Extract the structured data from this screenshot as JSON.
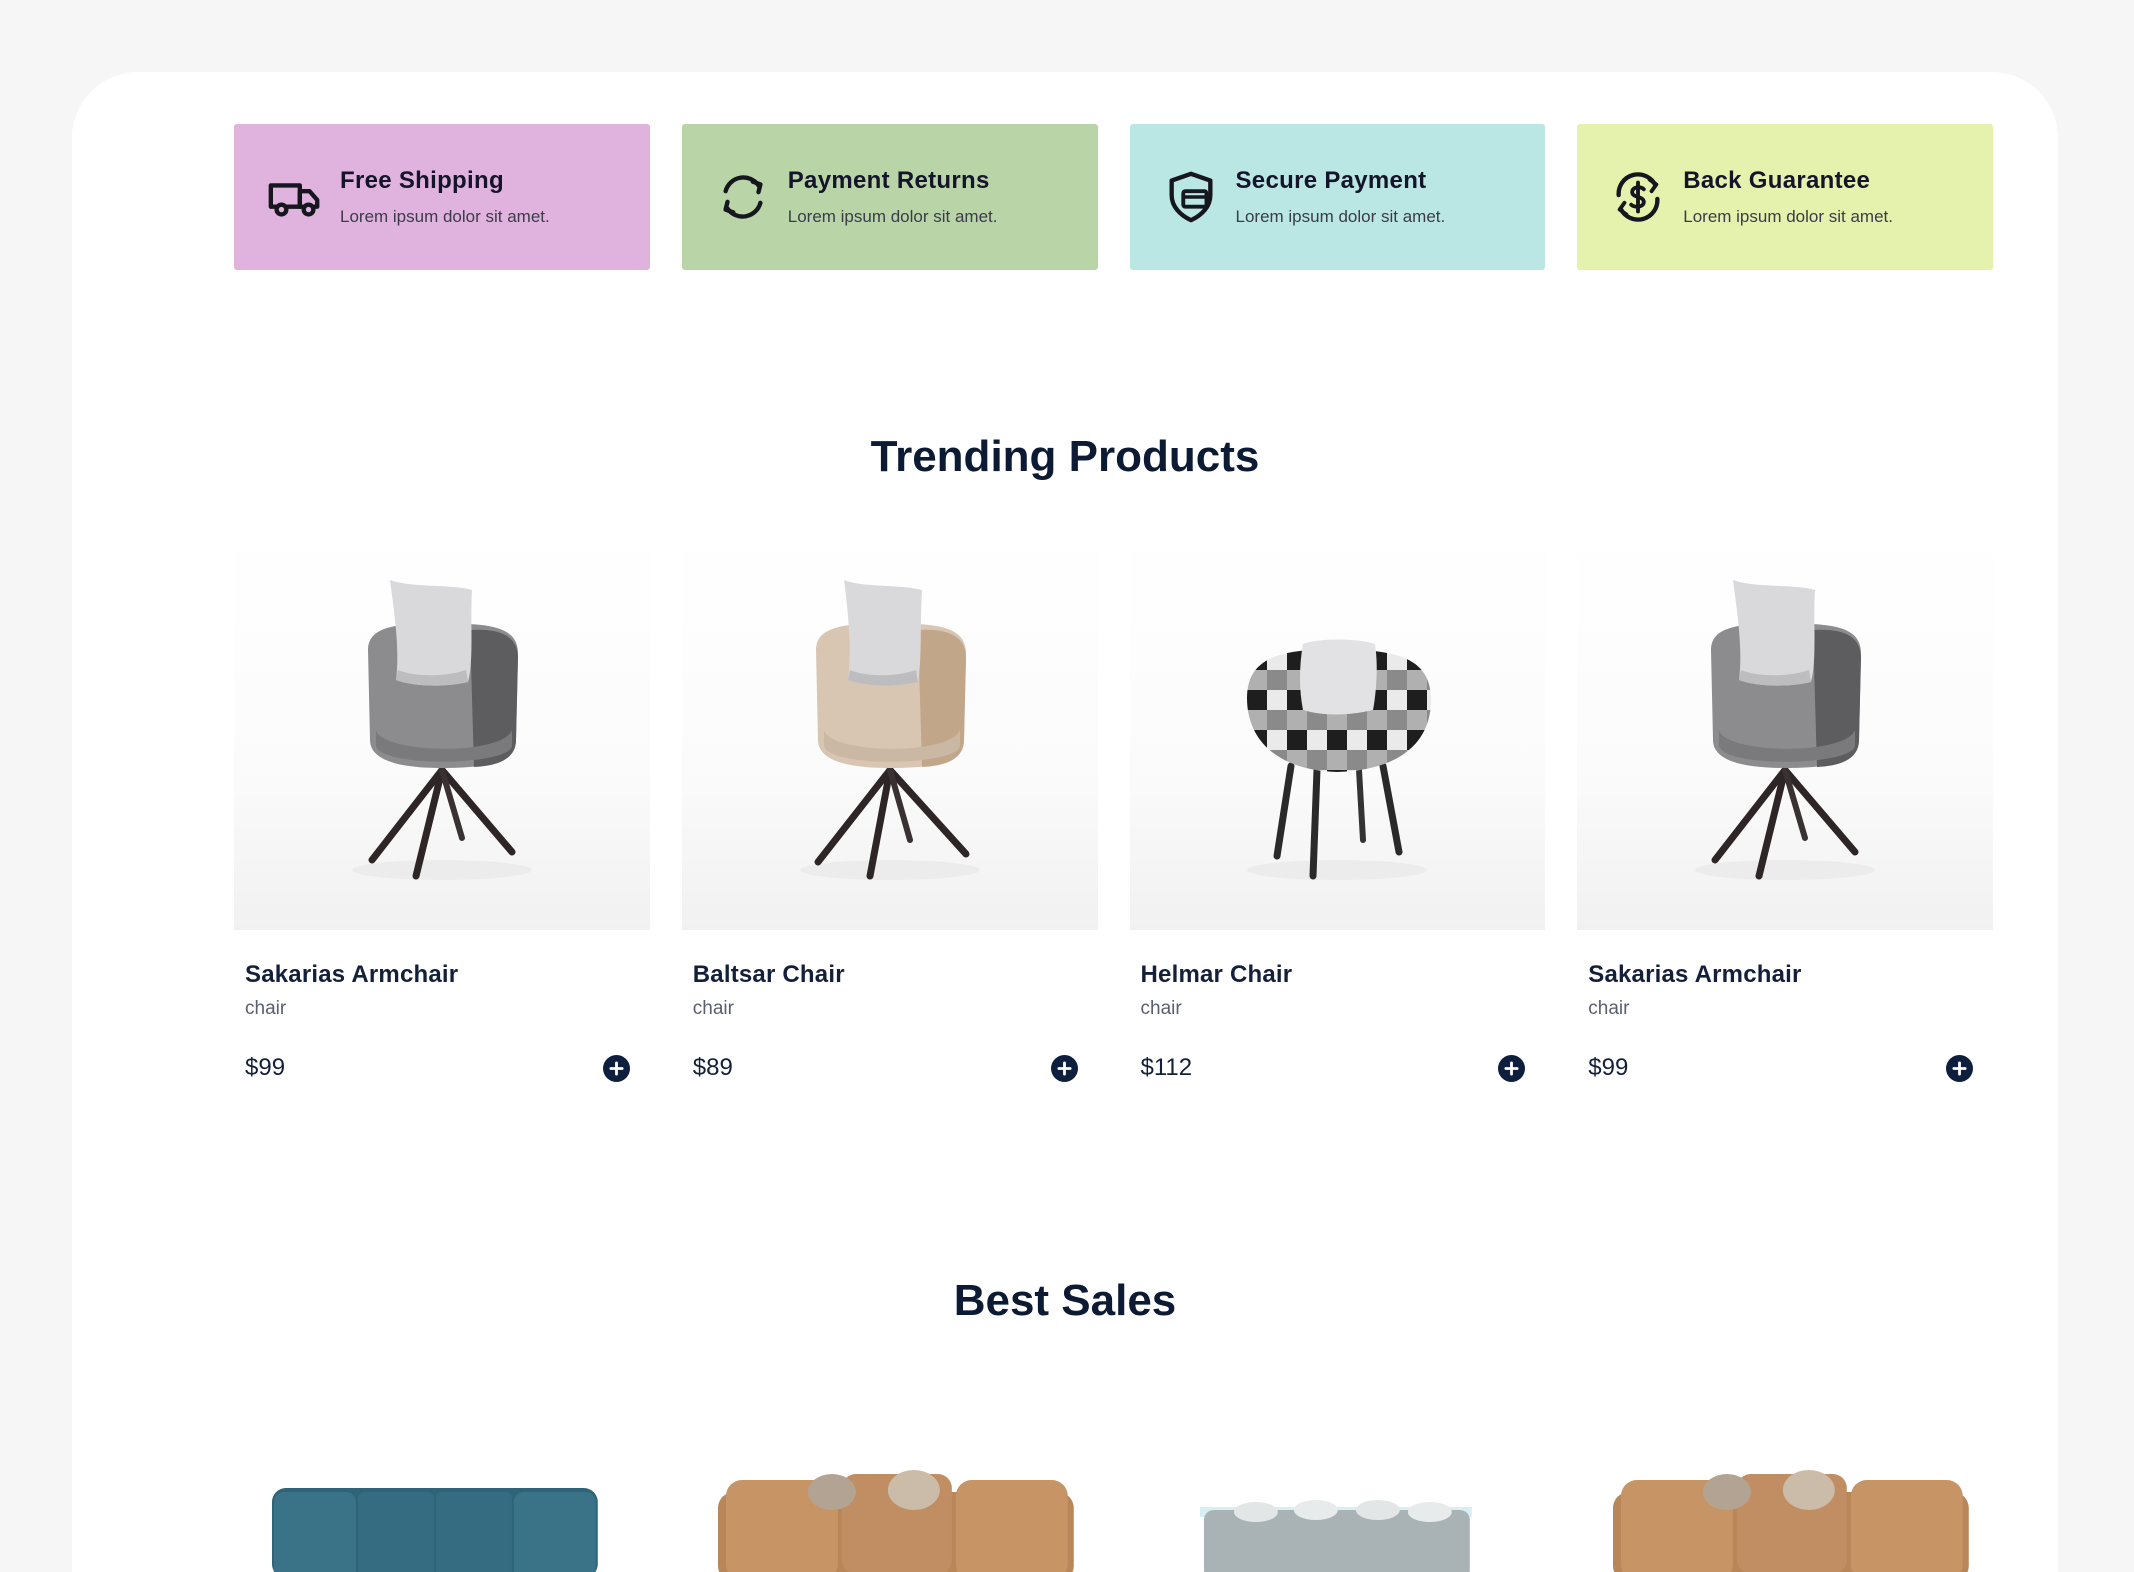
{
  "features": [
    {
      "title": "Free Shipping",
      "desc": "Lorem ipsum dolor sit amet.",
      "icon": "truck-icon",
      "color": "#e0b3de"
    },
    {
      "title": "Payment Returns",
      "desc": "Lorem ipsum dolor sit amet.",
      "icon": "refresh-icon",
      "color": "#b9d5a8"
    },
    {
      "title": "Secure Payment",
      "desc": "Lorem ipsum dolor sit amet.",
      "icon": "shield-icon",
      "color": "#bae7e3"
    },
    {
      "title": "Back Guarantee",
      "desc": "Lorem ipsum dolor sit amet.",
      "icon": "money-back-icon",
      "color": "#e4f2ad"
    }
  ],
  "trending": {
    "title": "Trending Products",
    "products": [
      {
        "name": "Sakarias Armchair",
        "category": "chair",
        "price": "$99",
        "image": "grey-armchair"
      },
      {
        "name": "Baltsar Chair",
        "category": "chair",
        "price": "$89",
        "image": "beige-armchair"
      },
      {
        "name": "Helmar Chair",
        "category": "chair",
        "price": "$112",
        "image": "plaid-armchair"
      },
      {
        "name": "Sakarias Armchair",
        "category": "chair",
        "price": "$99",
        "image": "grey-armchair"
      }
    ]
  },
  "best_sales": {
    "title": "Best Sales",
    "items": [
      {
        "image": "teal-sofa"
      },
      {
        "image": "tan-sofa"
      },
      {
        "image": "grey-sofa"
      },
      {
        "image": "tan-sofa"
      }
    ]
  },
  "colors": {
    "accent": "#0d1f3c",
    "background": "#f6f6f6"
  }
}
